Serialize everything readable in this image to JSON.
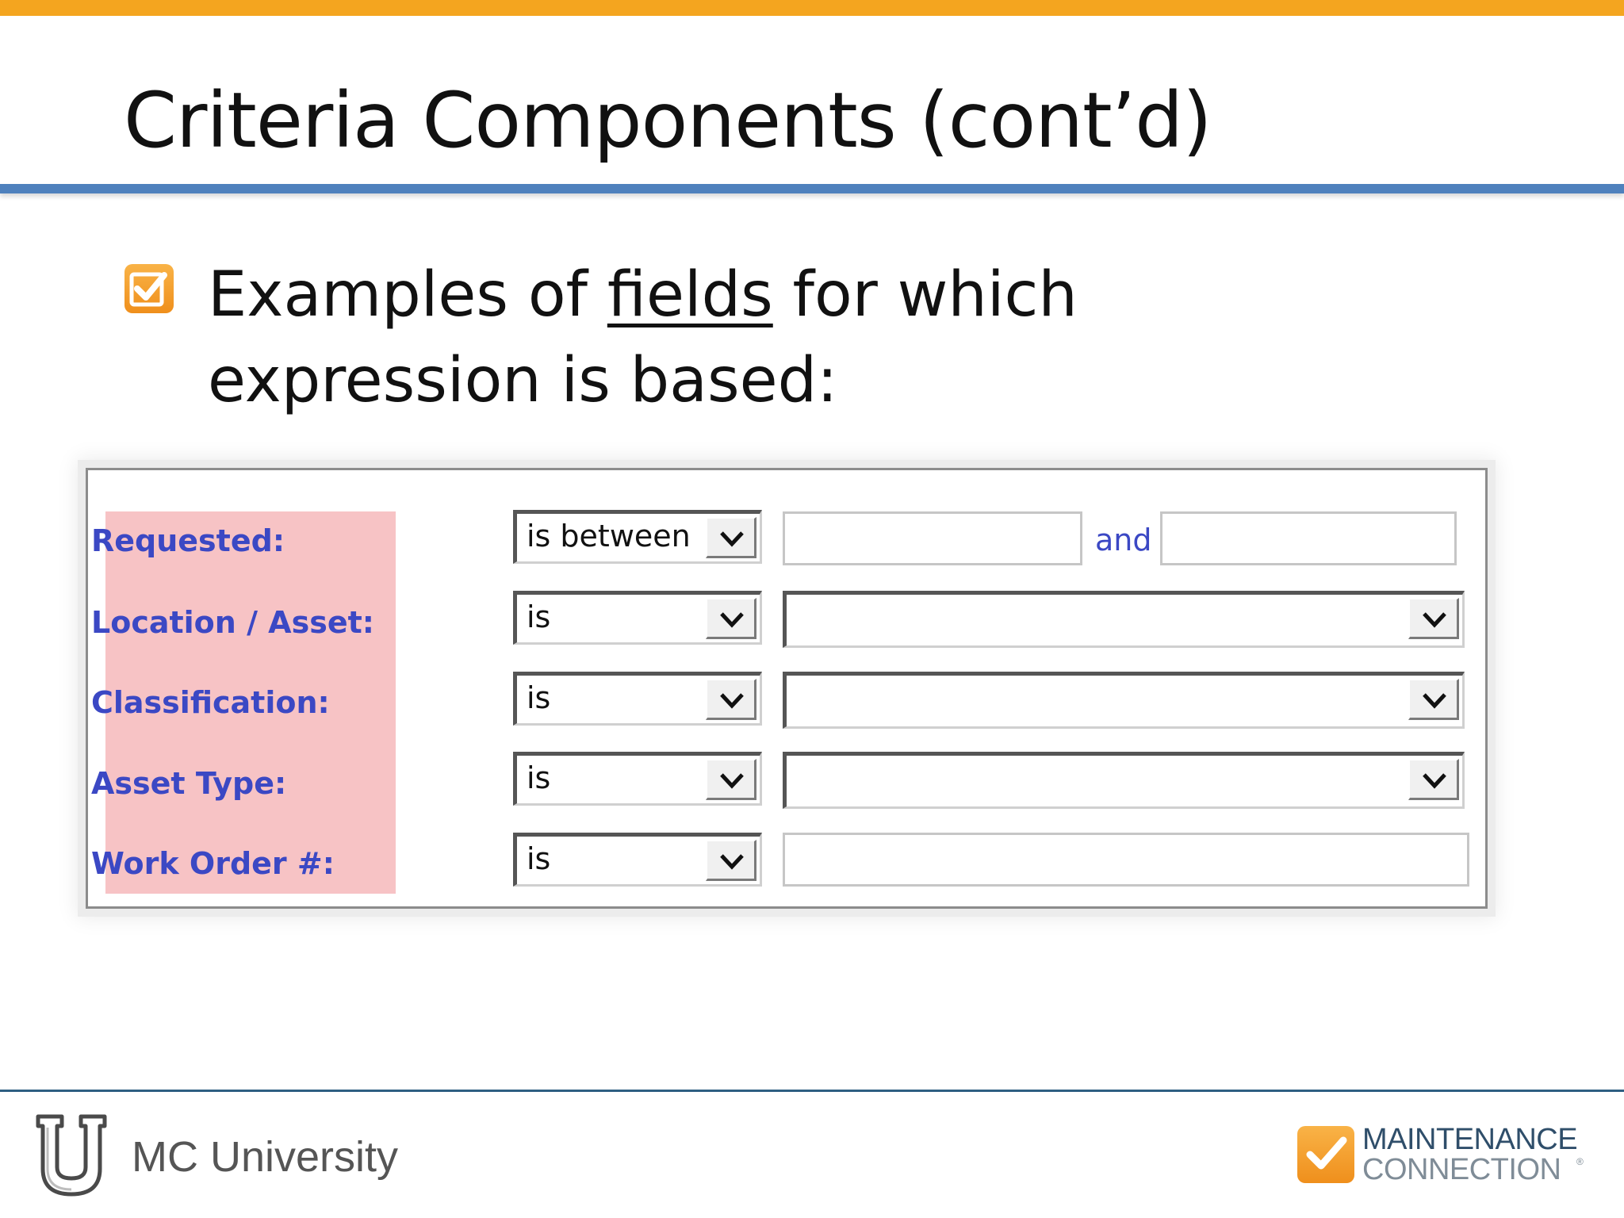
{
  "colors": {
    "top_bar": "#f4a51f",
    "title_rule": "#4f81bd",
    "accent_orange": "#f29b24",
    "label_background": "#f7c3c5",
    "label_text": "#3b48c4",
    "footer_rule": "#2e5f82",
    "brand_dark": "#2f4e6a",
    "brand_light": "#7f8c97"
  },
  "slide": {
    "title": "Criteria Components (cont’d)"
  },
  "bullet": {
    "icon": "checkbox-checked-icon",
    "text_before": "Examples of ",
    "text_underlined": "fields",
    "text_after": " for which expression is based:"
  },
  "criteria_form": {
    "and_label": "and",
    "rows": [
      {
        "label": "Requested:",
        "operator": "is between",
        "value_control": "range-textboxes"
      },
      {
        "label": "Location / Asset:",
        "operator": "is",
        "value_control": "dropdown"
      },
      {
        "label": "Classification:",
        "operator": "is",
        "value_control": "dropdown"
      },
      {
        "label": "Asset Type:",
        "operator": "is",
        "value_control": "dropdown"
      },
      {
        "label": "Work Order #:",
        "operator": "is",
        "value_control": "textbox"
      }
    ]
  },
  "footer": {
    "university_logo": "u-shield-icon",
    "university_name": "MC University",
    "brand_icon": "checkmark-icon",
    "brand_line1": "MAINTENANCE",
    "brand_line2": "CONNECTION",
    "brand_mark": "®"
  }
}
